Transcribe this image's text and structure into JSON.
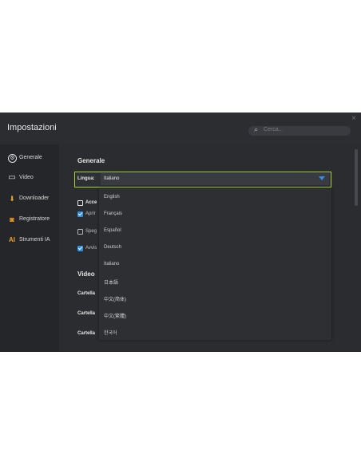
{
  "window": {
    "title": "Impostazioni",
    "close_glyph": "×"
  },
  "search": {
    "placeholder": "Cerca...",
    "icon": "search-icon"
  },
  "sidebar": {
    "items": [
      {
        "label": "Generale",
        "icon": "gear-icon",
        "glyph": "⚙",
        "color": "#e6e6e6"
      },
      {
        "label": "Video",
        "icon": "video-camera-icon",
        "glyph": "▭",
        "color": "#e6e6e6"
      },
      {
        "label": "Downloader",
        "icon": "download-icon",
        "glyph": "⬇",
        "color": "#f0a020"
      },
      {
        "label": "Registratore",
        "icon": "record-icon",
        "glyph": "◙",
        "color": "#f0a020"
      },
      {
        "label": "Strumenti IA",
        "icon": "ai-icon",
        "glyph": "AI",
        "color": "#f0a020"
      }
    ]
  },
  "main": {
    "section_general": "Generale",
    "language": {
      "label": "Lingua:",
      "value": "Italiano"
    },
    "options": [
      {
        "label": "Acce",
        "checked": false
      },
      {
        "label": "Aprir",
        "checked": true
      },
      {
        "label": "Speg",
        "checked": false
      },
      {
        "label": "Avvis",
        "checked": true
      }
    ],
    "section_video": "Video",
    "folders": [
      "Cartella",
      "Cartella",
      "Cartella"
    ]
  },
  "dropdown": {
    "options": [
      "English",
      "Français",
      "Español",
      "Deutsch",
      "Italiano",
      "日本語",
      "中文(简体)",
      "中文(繁體)",
      "한국어"
    ]
  },
  "colors": {
    "accent": "#a6d62f",
    "checkbox": "#2d8fe8",
    "icon_orange": "#f0a020"
  }
}
